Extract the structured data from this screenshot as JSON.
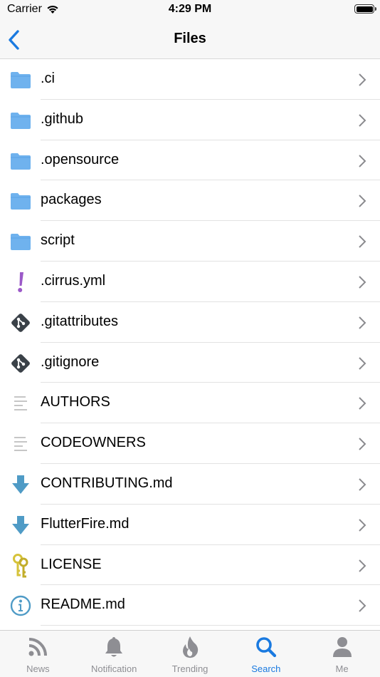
{
  "status_bar": {
    "carrier": "Carrier",
    "time": "4:29 PM"
  },
  "nav": {
    "title": "Files"
  },
  "files": [
    {
      "name": ".ci",
      "icon": "folder-icon"
    },
    {
      "name": ".github",
      "icon": "folder-icon"
    },
    {
      "name": ".opensource",
      "icon": "folder-icon"
    },
    {
      "name": "packages",
      "icon": "folder-icon"
    },
    {
      "name": "script",
      "icon": "folder-icon"
    },
    {
      "name": ".cirrus.yml",
      "icon": "exclamation-icon"
    },
    {
      "name": ".gitattributes",
      "icon": "git-icon"
    },
    {
      "name": ".gitignore",
      "icon": "git-icon"
    },
    {
      "name": "AUTHORS",
      "icon": "text-file-icon"
    },
    {
      "name": "CODEOWNERS",
      "icon": "text-file-icon"
    },
    {
      "name": "CONTRIBUTING.md",
      "icon": "markdown-arrow-icon"
    },
    {
      "name": "FlutterFire.md",
      "icon": "markdown-arrow-icon"
    },
    {
      "name": "LICENSE",
      "icon": "keys-icon"
    },
    {
      "name": "README.md",
      "icon": "info-icon"
    }
  ],
  "tabs": [
    {
      "label": "News",
      "icon": "rss-icon",
      "active": false
    },
    {
      "label": "Notification",
      "icon": "bell-icon",
      "active": false
    },
    {
      "label": "Trending",
      "icon": "flame-icon",
      "active": false
    },
    {
      "label": "Search",
      "icon": "search-icon",
      "active": true
    },
    {
      "label": "Me",
      "icon": "person-icon",
      "active": false
    }
  ],
  "colors": {
    "accent": "#1a7ae0",
    "folder": "#6fb2ee",
    "git": "#3a4148",
    "markdown": "#4f9bc6",
    "exclamation": "#9b59c8",
    "keys": "#d6c33a",
    "inactive_tab": "#8e8e93"
  }
}
